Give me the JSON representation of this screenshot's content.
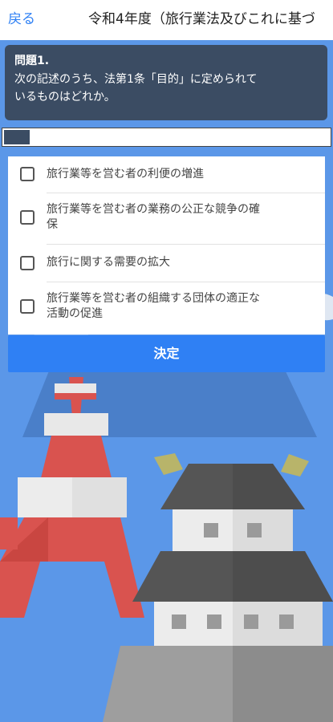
{
  "header": {
    "back_label": "戻る",
    "title": "令和4年度（旅行業法及びこれに基づ"
  },
  "question": {
    "number": "問題1.",
    "text_line1": "次の記述のうち、法第1条「目的」に定められて",
    "text_line2": "いるものはどれか。"
  },
  "progress": {
    "fraction": 0.08
  },
  "choices": [
    {
      "line1": "旅行業等を営む者の利便の増進",
      "line2": "",
      "checked": false
    },
    {
      "line1": "旅行業等を営む者の業務の公正な競争の確",
      "line2": "保",
      "checked": false
    },
    {
      "line1": "旅行に関する需要の拡大",
      "line2": "",
      "checked": false
    },
    {
      "line1": "旅行業等を営む者の組織する団体の適正な",
      "line2": "活動の促進",
      "checked": false
    }
  ],
  "submit_label": "決定",
  "colors": {
    "accent": "#2f80f4",
    "question_bg": "#3b4c63",
    "background_sky": "#5b97e8",
    "tower_red": "#d9534f",
    "castle_roof": "#555555"
  },
  "icons": [
    "checkbox-icon",
    "tokyo-tower-illustration",
    "castle-illustration"
  ]
}
